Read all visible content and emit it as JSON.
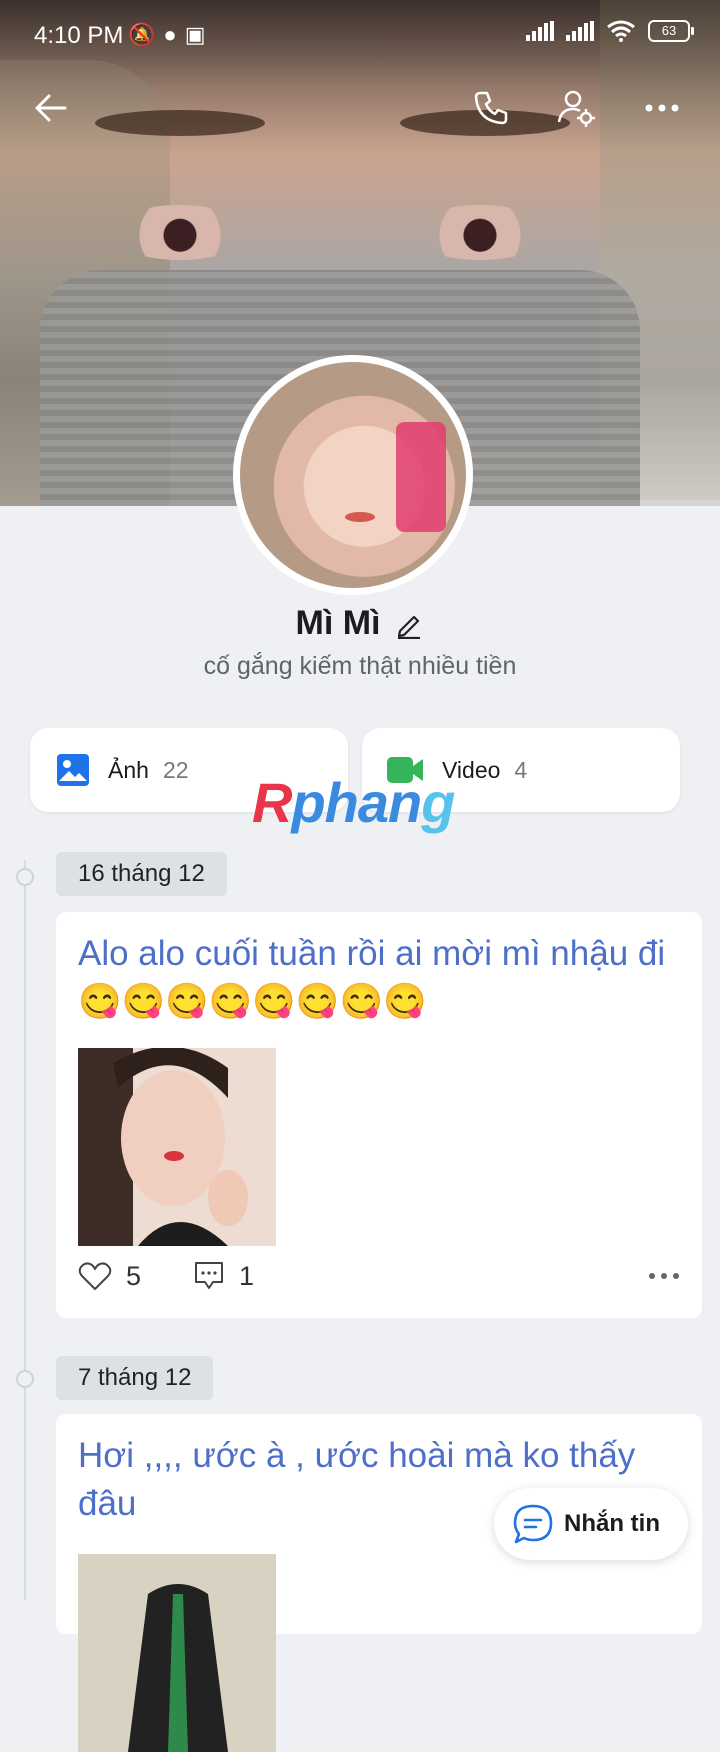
{
  "status_bar": {
    "time": "4:10 PM",
    "battery": "63",
    "notification_icons": [
      "mute-icon",
      "app-icon",
      "shop-icon"
    ]
  },
  "profile": {
    "name": "Mì Mì",
    "bio": "cố gắng kiếm thật nhiều tiền"
  },
  "media_cards": [
    {
      "label": "Ảnh",
      "count": "22",
      "icon": "image-icon",
      "color": "#1e73e8"
    },
    {
      "label": "Video",
      "count": "4",
      "icon": "video-icon",
      "color": "#35b45a"
    }
  ],
  "watermark": {
    "part1": "R",
    "part2": "phan",
    "part3": "g"
  },
  "posts": [
    {
      "date": "16 tháng 12",
      "text": "Alo alo cuối tuần rồi ai mời mì nhậu đi 😋😋😋😋😋😋😋😋",
      "likes": "5",
      "comments": "1"
    },
    {
      "date": "7 tháng 12",
      "text": "Hơi ,,,, ước à , ước hoài mà ko thấy đâu"
    }
  ],
  "message_button": {
    "label": "Nhắn tin"
  },
  "colors": {
    "accent": "#4d6fc9",
    "background": "#eef0f3"
  }
}
